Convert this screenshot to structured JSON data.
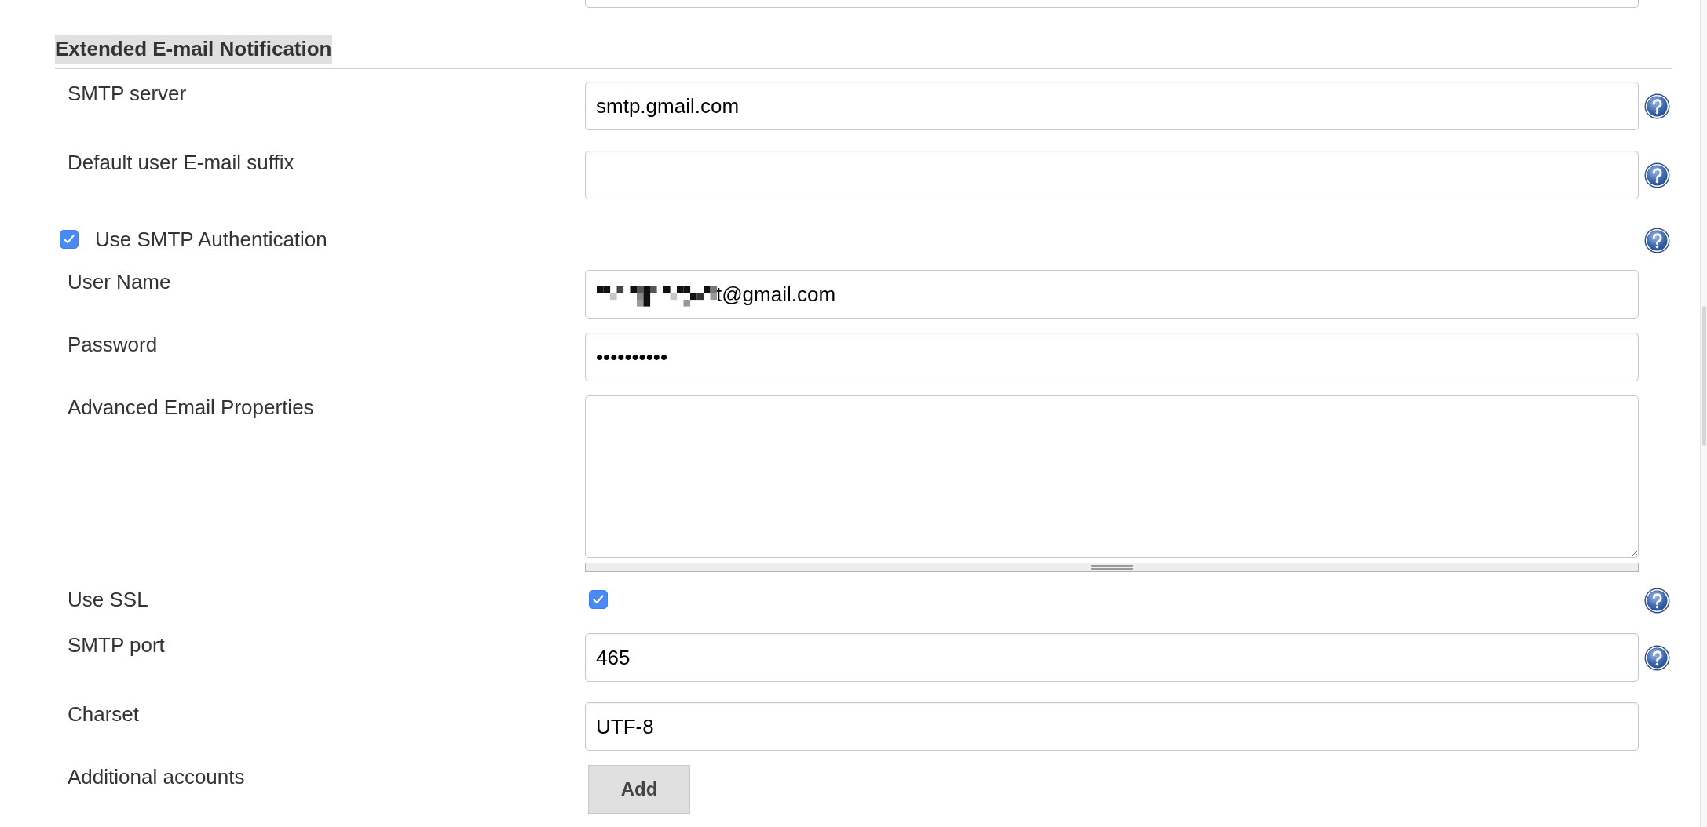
{
  "section": {
    "title": "Extended E-mail Notification"
  },
  "fields": [
    {
      "kind": "text",
      "label": "SMTP server",
      "value": "smtp.gmail.com",
      "help": true
    },
    {
      "kind": "text",
      "label": "Default user E-mail suffix",
      "help": true
    },
    {
      "kind": "optional",
      "label": "Use SMTP Authentication",
      "checked": true,
      "help": true
    },
    {
      "kind": "text",
      "label": "User Name",
      "value": "t@gmail.com",
      "redacted": true,
      "help": false
    },
    {
      "kind": "text",
      "label": "Password",
      "value": "••••••••••",
      "help": false
    },
    {
      "kind": "textarea",
      "label": "Advanced Email Properties",
      "help": false
    },
    {
      "kind": "checkbox",
      "label": "Use SSL",
      "checked": true,
      "help": true
    },
    {
      "kind": "text",
      "label": "SMTP port",
      "value": "465",
      "help": true
    },
    {
      "kind": "text",
      "label": "Charset",
      "value": "UTF-8",
      "help": false
    },
    {
      "kind": "button",
      "label": "Additional accounts",
      "button": "Add",
      "help": false
    }
  ]
}
